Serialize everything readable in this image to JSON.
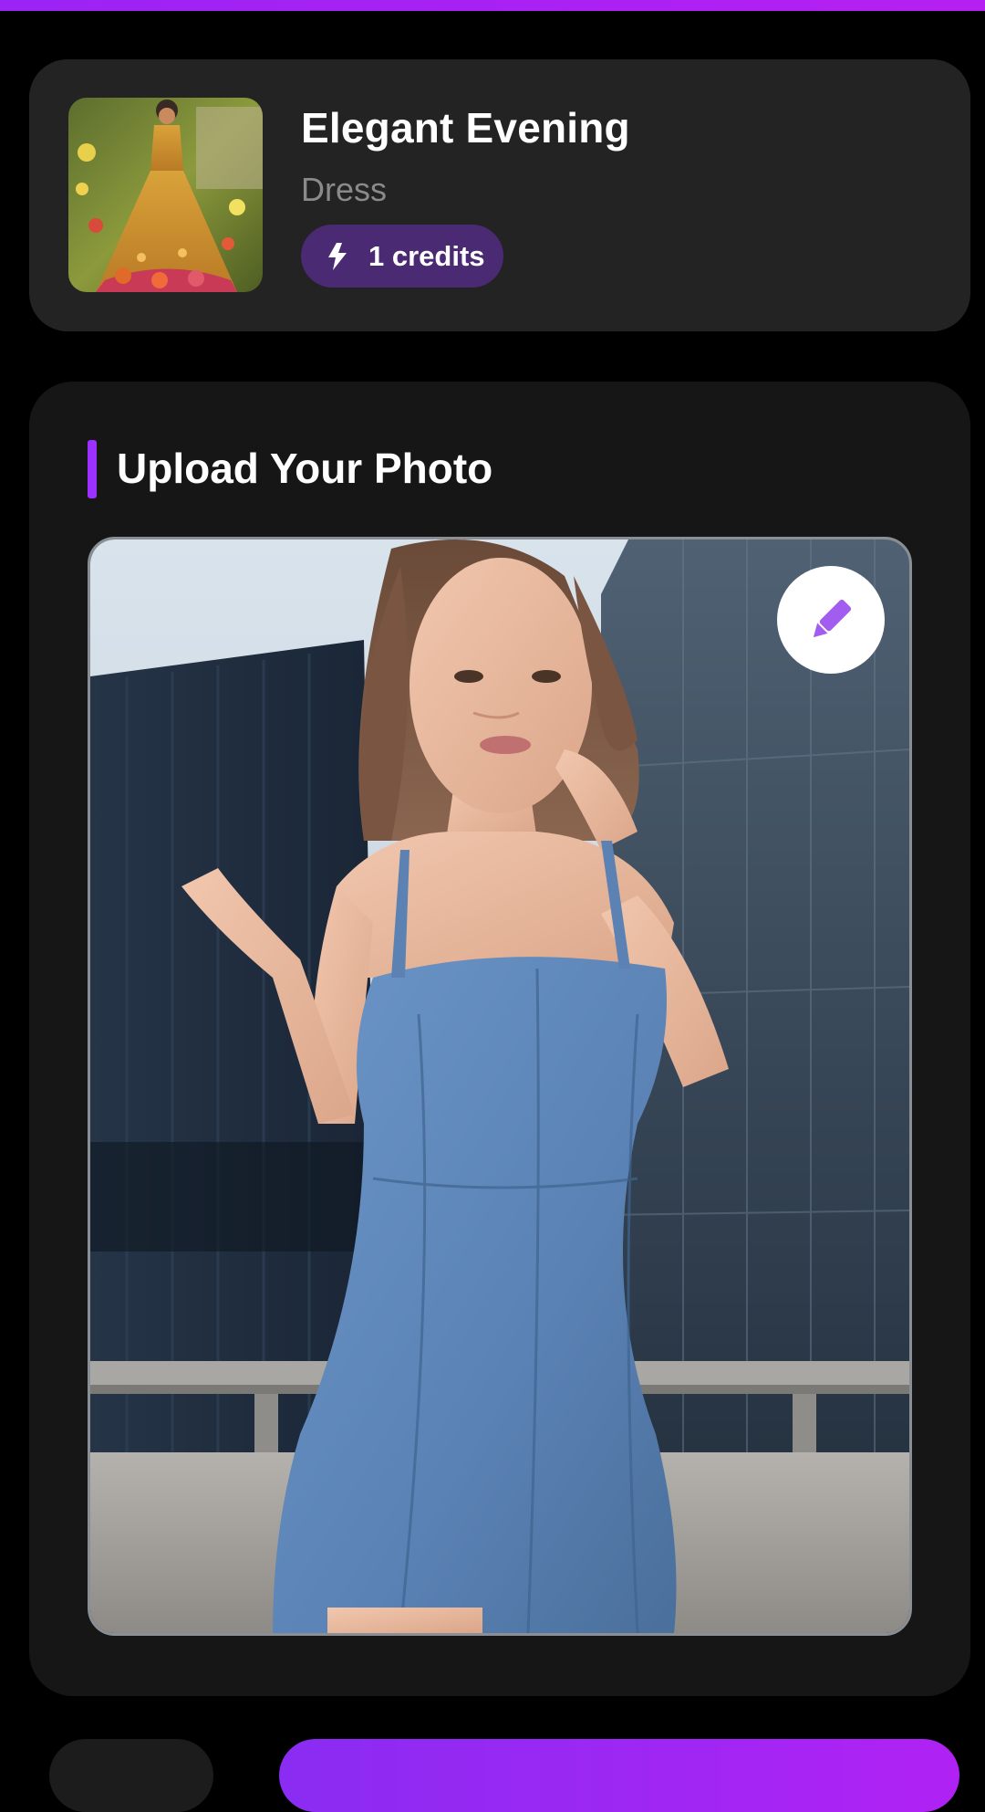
{
  "style_card": {
    "title": "Elegant Evening",
    "category": "Dress",
    "credits_label": "1 credits",
    "thumbnail": "gold-embroidered-gown-photo"
  },
  "upload": {
    "title": "Upload Your Photo",
    "photo": "woman-in-denim-dress-photo",
    "edit_icon": "pencil-icon"
  },
  "colors": {
    "accent": "#9b30ff",
    "card_bg": "#232323",
    "pill_bg": "#4a2a73",
    "page_bg": "#000000"
  },
  "icons": {
    "credits": "lightning-bolt-icon",
    "edit": "pencil-icon"
  }
}
